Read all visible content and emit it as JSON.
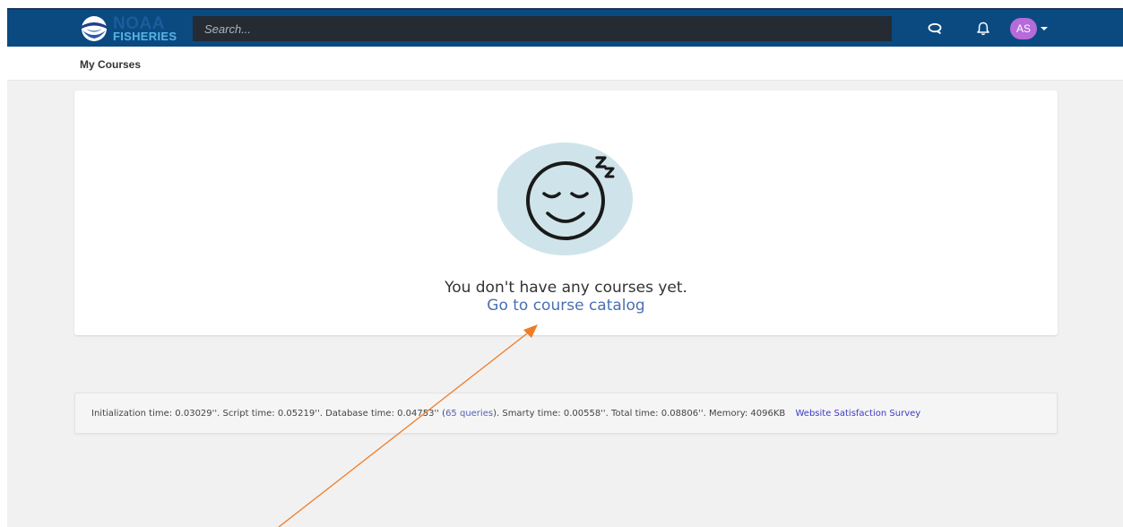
{
  "header": {
    "logo": {
      "word_top": "NOAA",
      "word_bottom": "FISHERIES",
      "icon": "noaa-logo-icon"
    },
    "search": {
      "placeholder": "Search..."
    },
    "icons": [
      "chat-icon",
      "bell-icon"
    ],
    "avatar_initials": "AS",
    "colors": {
      "bar": "#0b4a80",
      "avatar": "#b56bd9",
      "search_bg": "#242b33"
    }
  },
  "subheader": {
    "title": "My Courses"
  },
  "main": {
    "empty_state": {
      "icon": "sleeping-face-icon",
      "message": "You don't have any courses yet.",
      "link_label": "Go to course catalog"
    }
  },
  "footer": {
    "init_time": "Initialization time: 0.03029''.",
    "script_time": "Script time: 0.05219''.",
    "db_time": "Database time: 0.04753''",
    "queries_open": "(",
    "queries_link": "65 queries",
    "queries_close": ").",
    "smarty_time": "Smarty time: 0.00558''.",
    "total_time": "Total time: 0.08806''.",
    "memory": "Memory: 4096KB",
    "survey_link": "Website Satisfaction Survey"
  },
  "annotation": {
    "arrow_color": "#f07c26"
  }
}
